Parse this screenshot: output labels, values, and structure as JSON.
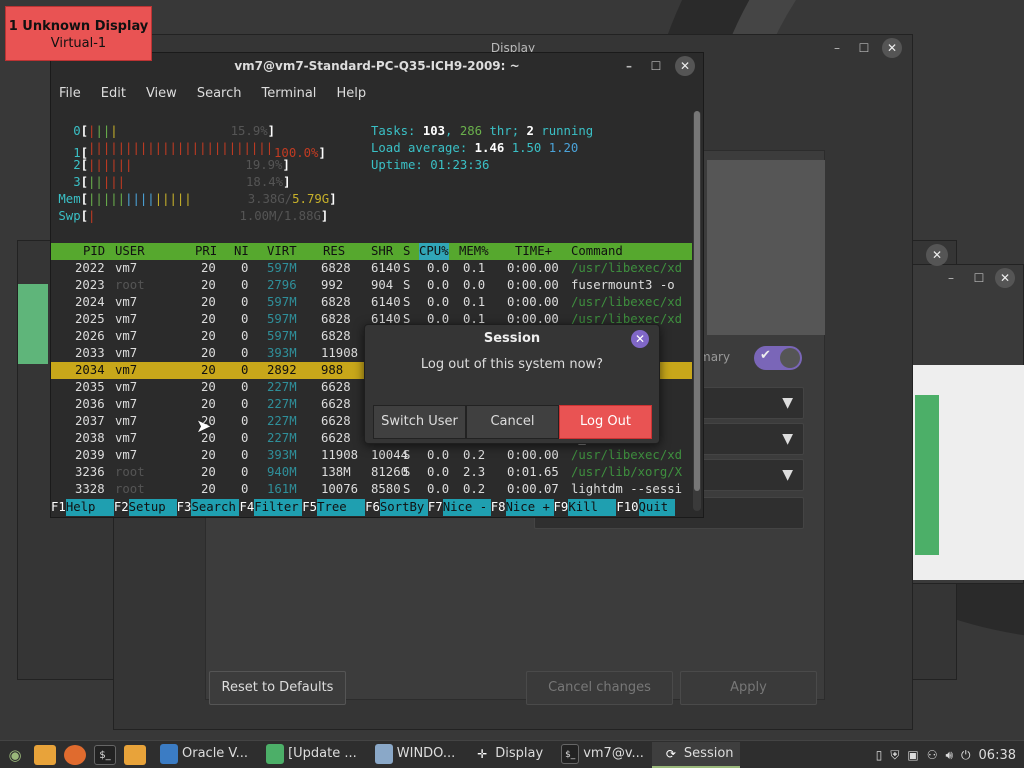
{
  "display_badge": {
    "title": "1 Unknown Display",
    "subtitle": "Virtual-1"
  },
  "display_window": {
    "title": "Display",
    "primary_label": "mary",
    "reset_label": "Reset to Defaults",
    "cancel_label": "Cancel changes",
    "apply_label": "Apply"
  },
  "terminal": {
    "title": "vm7@vm7-Standard-PC-Q35-ICH9-2009: ~",
    "menu": [
      "File",
      "Edit",
      "View",
      "Search",
      "Terminal",
      "Help"
    ],
    "cpu_meters": [
      {
        "id": "0",
        "bar": "||||",
        "pct": "15.9%"
      },
      {
        "id": "1",
        "bar": "||||||||||||||||||||||||||||||||||||||||||||||",
        "pct": "100.0%"
      },
      {
        "id": "2",
        "bar": "||||||",
        "pct": "19.9%"
      },
      {
        "id": "3",
        "bar": "|||||",
        "pct": "18.4%"
      }
    ],
    "mem": {
      "label": "Mem",
      "used": "3.38G",
      "total": "5.79G"
    },
    "swp": {
      "label": "Swp",
      "used": "1.00M",
      "total": "1.88G"
    },
    "tasks": {
      "label": "Tasks:",
      "count": "103",
      "thr": "286",
      "thr_label": "thr;",
      "running": "2",
      "running_label": "running"
    },
    "load": {
      "label": "Load average:",
      "v1": "1.46",
      "v2": "1.50",
      "v3": "1.20"
    },
    "uptime": {
      "label": "Uptime:",
      "value": "01:23:36"
    },
    "columns": [
      "PID",
      "USER",
      "PRI",
      "NI",
      "VIRT",
      "RES",
      "SHR",
      "S",
      "CPU%",
      "MEM%",
      "TIME+",
      "Command"
    ],
    "rows": [
      {
        "pid": "2022",
        "user": "vm7",
        "pri": "20",
        "ni": "0",
        "virt": "597M",
        "res": "6828",
        "shr": "6140",
        "s": "S",
        "cpu": "0.0",
        "mem": "0.1",
        "time": "0:00.00",
        "cmd": "/usr/libexec/xd"
      },
      {
        "pid": "2023",
        "user": "root",
        "pri": "20",
        "ni": "0",
        "virt": "2796",
        "res": "992",
        "shr": "904",
        "s": "S",
        "cpu": "0.0",
        "mem": "0.0",
        "time": "0:00.00",
        "cmd": "fusermount3 -o"
      },
      {
        "pid": "2024",
        "user": "vm7",
        "pri": "20",
        "ni": "0",
        "virt": "597M",
        "res": "6828",
        "shr": "6140",
        "s": "S",
        "cpu": "0.0",
        "mem": "0.1",
        "time": "0:00.00",
        "cmd": "/usr/libexec/xd"
      },
      {
        "pid": "2025",
        "user": "vm7",
        "pri": "20",
        "ni": "0",
        "virt": "597M",
        "res": "6828",
        "shr": "6140",
        "s": "S",
        "cpu": "0.0",
        "mem": "0.1",
        "time": "0:00.00",
        "cmd": "/usr/libexec/xd"
      },
      {
        "pid": "2026",
        "user": "vm7",
        "pri": "20",
        "ni": "0",
        "virt": "597M",
        "res": "6828",
        "shr": "",
        "s": "",
        "cpu": "",
        "mem": "",
        "time": "",
        "cmd": "xd"
      },
      {
        "pid": "2033",
        "user": "vm7",
        "pri": "20",
        "ni": "0",
        "virt": "393M",
        "res": "11908",
        "shr": "",
        "s": "",
        "cpu": "",
        "mem": "",
        "time": "",
        "cmd": "xd"
      },
      {
        "pid": "2034",
        "user": "vm7",
        "pri": "20",
        "ni": "0",
        "virt": "2892",
        "res": "988",
        "shr": "",
        "s": "",
        "cpu": "",
        "mem": "",
        "time": "",
        "cmd": "lib/"
      },
      {
        "pid": "2035",
        "user": "vm7",
        "pri": "20",
        "ni": "0",
        "virt": "227M",
        "res": "6628",
        "shr": "",
        "s": "",
        "cpu": "",
        "mem": "",
        "time": "",
        "cmd": "6_64"
      },
      {
        "pid": "2036",
        "user": "vm7",
        "pri": "20",
        "ni": "0",
        "virt": "227M",
        "res": "6628",
        "shr": "",
        "s": "",
        "cpu": "",
        "mem": "",
        "time": "",
        "cmd": "6_64"
      },
      {
        "pid": "2037",
        "user": "vm7",
        "pri": "20",
        "ni": "0",
        "virt": "227M",
        "res": "6628",
        "shr": "",
        "s": "",
        "cpu": "",
        "mem": "",
        "time": "",
        "cmd": "6_64"
      },
      {
        "pid": "2038",
        "user": "vm7",
        "pri": "20",
        "ni": "0",
        "virt": "227M",
        "res": "6628",
        "shr": "",
        "s": "",
        "cpu": "",
        "mem": "",
        "time": "",
        "cmd": "6_64"
      },
      {
        "pid": "2039",
        "user": "vm7",
        "pri": "20",
        "ni": "0",
        "virt": "393M",
        "res": "11908",
        "shr": "10044",
        "s": "S",
        "cpu": "0.0",
        "mem": "0.2",
        "time": "0:00.00",
        "cmd": "/usr/libexec/xd"
      },
      {
        "pid": "3236",
        "user": "root",
        "pri": "20",
        "ni": "0",
        "virt": "940M",
        "res": "138M",
        "shr": "81260",
        "s": "S",
        "cpu": "0.0",
        "mem": "2.3",
        "time": "0:01.65",
        "cmd": "/usr/lib/xorg/X"
      },
      {
        "pid": "3328",
        "user": "root",
        "pri": "20",
        "ni": "0",
        "virt": "161M",
        "res": "10076",
        "shr": "8580",
        "s": "S",
        "cpu": "0.0",
        "mem": "0.2",
        "time": "0:00.07",
        "cmd": "lightdm --sessi"
      }
    ],
    "fkeys": [
      {
        "k": "F1",
        "l": "Help"
      },
      {
        "k": "F2",
        "l": "Setup"
      },
      {
        "k": "F3",
        "l": "Search"
      },
      {
        "k": "F4",
        "l": "Filter"
      },
      {
        "k": "F5",
        "l": "Tree"
      },
      {
        "k": "F6",
        "l": "SortBy"
      },
      {
        "k": "F7",
        "l": "Nice -"
      },
      {
        "k": "F8",
        "l": "Nice +"
      },
      {
        "k": "F9",
        "l": "Kill"
      },
      {
        "k": "F10",
        "l": "Quit"
      }
    ]
  },
  "session_dialog": {
    "title": "Session",
    "message": "Log out of this system now?",
    "switch_user": "Switch User",
    "cancel": "Cancel",
    "log_out": "Log Out"
  },
  "taskbar": {
    "items": [
      {
        "label": "Oracle V...",
        "icon": "virtualbox-icon"
      },
      {
        "label": "[Update ...",
        "icon": "update-manager-icon"
      },
      {
        "label": "WINDO...",
        "icon": "screenshot-icon"
      },
      {
        "label": "Display",
        "icon": "display-settings-icon"
      },
      {
        "label": "vm7@v...",
        "icon": "terminal-icon"
      },
      {
        "label": "Session",
        "icon": "session-icon"
      }
    ],
    "clock": "06:38"
  },
  "colors": {
    "accent_red": "#e95353",
    "accent_purple": "#8067c7",
    "htop_green": "#56a82e",
    "htop_cyan": "#1f9fb0"
  }
}
